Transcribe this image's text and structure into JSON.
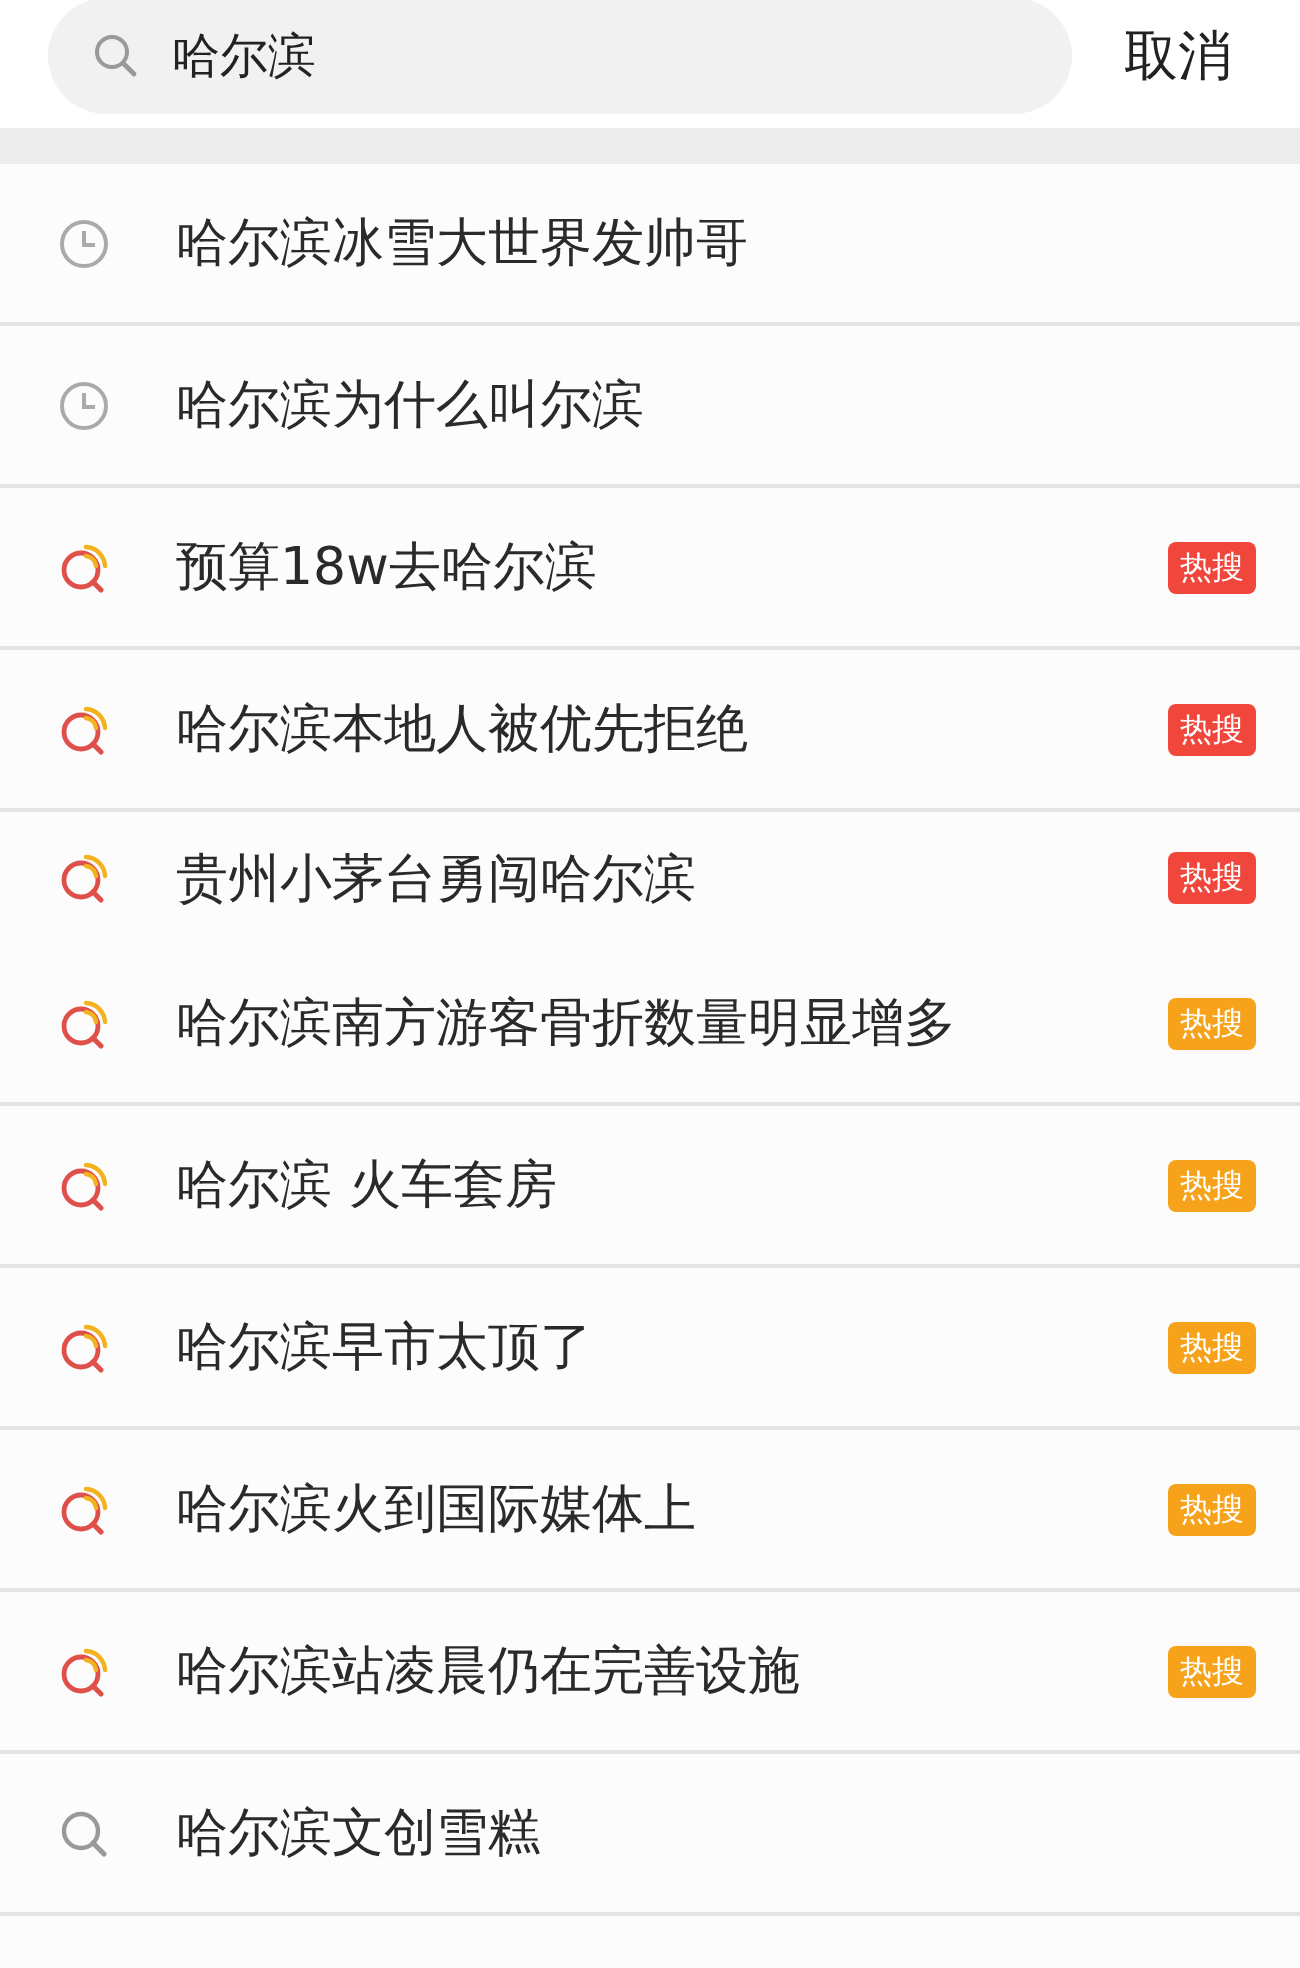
{
  "search": {
    "value": "哈尔滨"
  },
  "cancel": "取消",
  "suggestions": [
    {
      "kind": "history",
      "text": "哈尔滨冰雪大世界发帅哥",
      "divider": true
    },
    {
      "kind": "history",
      "text": "哈尔滨为什么叫尔滨",
      "divider": true
    },
    {
      "kind": "hot",
      "text": "预算18w去哈尔滨",
      "badge": "热搜",
      "color": "#f0463c",
      "divider": true
    },
    {
      "kind": "hot",
      "text": "哈尔滨本地人被优先拒绝",
      "badge": "热搜",
      "color": "#f0463c",
      "divider": true
    },
    {
      "kind": "hot",
      "text": "贵州小茅台勇闯哈尔滨",
      "badge": "热搜",
      "color": "#f0463c",
      "divider": false
    },
    {
      "kind": "hot",
      "text": "哈尔滨南方游客骨折数量明显增多",
      "badge": "热搜",
      "color": "#f7a21b",
      "divider": true
    },
    {
      "kind": "hot",
      "text": "哈尔滨 火车套房",
      "badge": "热搜",
      "color": "#f7a21b",
      "divider": true
    },
    {
      "kind": "hot",
      "text": "哈尔滨早市太顶了",
      "badge": "热搜",
      "color": "#f7a21b",
      "divider": true
    },
    {
      "kind": "hot",
      "text": "哈尔滨火到国际媒体上",
      "badge": "热搜",
      "color": "#f7a21b",
      "divider": true
    },
    {
      "kind": "hot",
      "text": "哈尔滨站凌晨仍在完善设施",
      "badge": "热搜",
      "color": "#f7a21b",
      "divider": true
    },
    {
      "kind": "search",
      "text": "哈尔滨文创雪糕",
      "divider": true
    }
  ]
}
